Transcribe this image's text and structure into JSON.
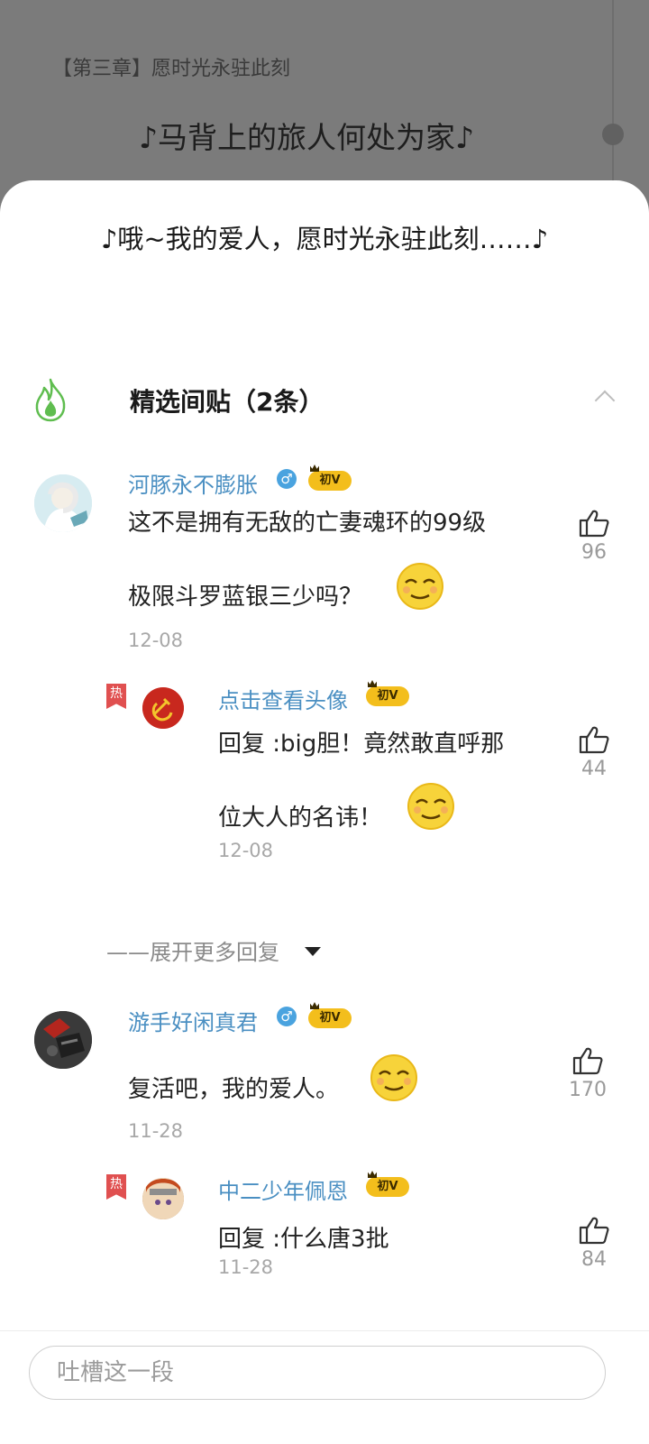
{
  "background": {
    "chapter_title": "【第三章】愿时光永驻此刻",
    "lyric": "♪马背上的旅人何处为家♪"
  },
  "sheet": {
    "lyric": "♪哦~我的爱人，愿时光永驻此刻……♪",
    "section_title": "精选间贴（2条）",
    "more_replies": "——展开更多回复"
  },
  "comments": [
    {
      "user": "河豚永不膨胀",
      "gender": "♂",
      "level": "初V",
      "text": [
        "这不是拥有无敌的亡妻魂环的99级",
        "极限斗罗蓝银三少吗？"
      ],
      "date": "12-08",
      "likes": "96",
      "reply": {
        "badge": "热",
        "user": "点击查看头像",
        "level": "初V",
        "text": [
          "回复 :big胆！竟然敢直呼那",
          "位大人的名讳！"
        ],
        "date": "12-08",
        "likes": "44"
      }
    },
    {
      "user": "游手好闲真君",
      "gender": "♂",
      "level": "初V",
      "text": [
        "复活吧，我的爱人。"
      ],
      "date": "11-28",
      "likes": "170",
      "reply": {
        "badge": "热",
        "user": "中二少年佩恩",
        "level": "初V",
        "text": [
          "回复 :什么唐3批"
        ],
        "date": "11-28",
        "likes": "84"
      }
    }
  ],
  "input": {
    "placeholder": "吐槽这一段"
  },
  "colors": {
    "username": "#4a8fc2",
    "level_badge": "#f3be1c",
    "hot_badge": "#e05050",
    "flame": "#5fbd4f"
  }
}
